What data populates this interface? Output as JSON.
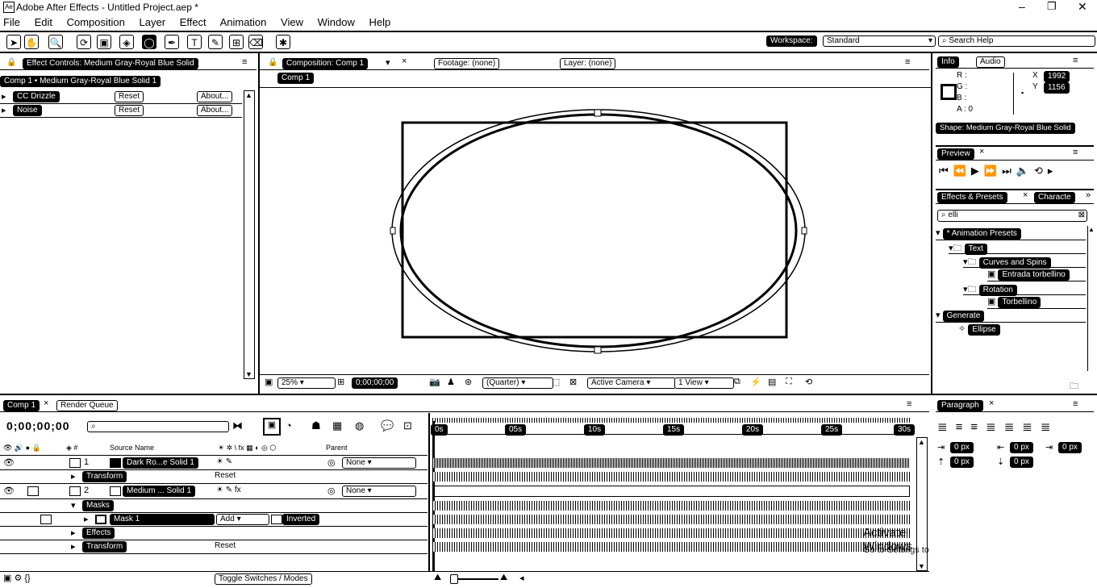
{
  "app": {
    "title": "Adobe After Effects - Untitled Project.aep *"
  },
  "menu": [
    "File",
    "Edit",
    "Composition",
    "Layer",
    "Effect",
    "Animation",
    "View",
    "Window",
    "Help"
  ],
  "toolbar": {
    "workspace_label": "Workspace:",
    "workspace_value": "Standard",
    "search_placeholder": "Search Help"
  },
  "effect_controls": {
    "tab": "Effect Controls: Medium Gray-Royal Blue Solid",
    "breadcrumb": "Comp 1 • Medium Gray-Royal Blue Solid 1",
    "effects": [
      {
        "name": "CC Drizzle",
        "reset": "Reset",
        "about": "About..."
      },
      {
        "name": "Noise",
        "reset": "Reset",
        "about": "About..."
      }
    ]
  },
  "composition": {
    "tab": "Composition: Comp 1",
    "footage_tab": "Footage: (none)",
    "layer_tab": "Layer: (none)",
    "crumb": "Comp 1",
    "zoom": "25%",
    "timecode": "0;00;00;00",
    "resolution": "(Quarter)",
    "camera": "Active Camera",
    "view": "1 View"
  },
  "info": {
    "tab": "Info",
    "audio_tab": "Audio",
    "r": "R :",
    "g": "G :",
    "b": "B :",
    "a": "A : 0",
    "x_label": "X",
    "x_value": "1992",
    "y_label": "Y",
    "y_value": "1156",
    "shape": "Shape: Medium Gray-Royal Blue Solid"
  },
  "preview": {
    "tab": "Preview"
  },
  "effects_presets": {
    "tab": "Effects & Presets",
    "char_tab": "Characte",
    "search_value": "elli",
    "tree": [
      {
        "label": "* Animation Presets",
        "level": 0
      },
      {
        "label": "Text",
        "level": 1
      },
      {
        "label": "Curves and Spins",
        "level": 2
      },
      {
        "label": "Entrada torbellino",
        "level": 3
      },
      {
        "label": "Rotation",
        "level": 2
      },
      {
        "label": "Torbellino",
        "level": 3
      },
      {
        "label": "Generate",
        "level": 0
      },
      {
        "label": "Ellipse",
        "level": 1
      }
    ]
  },
  "paragraph": {
    "tab": "Paragraph",
    "fields": [
      "0 px",
      "0 px",
      "0 px",
      "0 px",
      "0 px"
    ]
  },
  "timeline": {
    "tab_comp": "Comp 1",
    "tab_render": "Render Queue",
    "timecode": "0;00;00;00",
    "col_source": "Source Name",
    "col_parent": "Parent",
    "ruler": [
      "0s",
      "05s",
      "10s",
      "15s",
      "20s",
      "25s",
      "30s"
    ],
    "layers": [
      {
        "num": "1",
        "name": "Dark Ro...e Solid 1",
        "parent": "None"
      },
      {
        "num": "2",
        "name": "Medium ... Solid 1",
        "parent": "None"
      }
    ],
    "transform_label": "Transform",
    "reset_label": "Reset",
    "masks_label": "Masks",
    "mask_name": "Mask 1",
    "mask_mode": "Add",
    "inverted_label": "Inverted",
    "effects_label": "Effects",
    "toggle_label": "Toggle Switches / Modes"
  },
  "watermark": {
    "line1": "Activate Windows",
    "line2": "Go to Settings to activate Windows."
  }
}
